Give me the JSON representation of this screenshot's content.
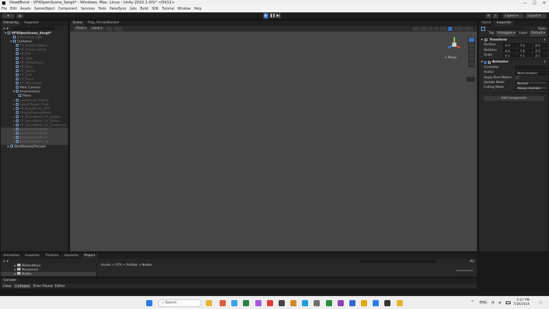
{
  "window": {
    "title": "DeadBurst - VFXOpenScene_Sergii* - Windows, Mac, Linux - Unity 2022.1.0f1* <DX11>",
    "controls": [
      "—",
      "☐",
      "✕"
    ]
  },
  "menu": [
    "File",
    "Edit",
    "Assets",
    "GameObject",
    "Component",
    "Services",
    "Tools",
    "PanelSync",
    "Jobs",
    "Build",
    "SDK",
    "Tutorial",
    "Window",
    "Help"
  ],
  "toolbar": {
    "layers_label": "Layers",
    "layout_label": "Layout"
  },
  "hierarchy": {
    "tab_hierarchy": "Hierarchy",
    "tab_inspector": "Inspector",
    "scene_name": "VFXOpenScene_Sergii*",
    "items": [
      {
        "label": "Container",
        "dim": false
      },
      {
        "label": "Container",
        "dim": false
      },
      {
        "label": "FX_DistanceWave",
        "dim": true
      },
      {
        "label": "FX_DistanceGlow",
        "dim": true
      },
      {
        "label": "FX_Orb",
        "dim": true
      },
      {
        "label": "FX_Tube",
        "dim": true
      },
      {
        "label": "FX_PortalCloud",
        "dim": true
      },
      {
        "label": "FX_Wisp",
        "dim": true
      },
      {
        "label": "FX_Sparks",
        "dim": true
      },
      {
        "label": "FX_Trail",
        "dim": true
      },
      {
        "label": "FX_Burst",
        "dim": true
      },
      {
        "label": "FX_ShockTube",
        "dim": true
      },
      {
        "label": "Main Camera",
        "dim": false
      },
      {
        "label": "Environment",
        "dim": false
      },
      {
        "label": "Plane",
        "dim": false
      },
      {
        "label": "LookAtCam_Parent",
        "dim": true
      },
      {
        "label": "LookAtTarget_Final",
        "dim": true
      },
      {
        "label": "FX_BodyNodes_VFX",
        "dim": true
      },
      {
        "label": "SimpleCameraMode",
        "dim": true
      },
      {
        "label": "FX_ShockNode_Hit_Stable",
        "dim": true
      },
      {
        "label": "FX_ShockNode_Hit_Direct",
        "dim": true
      },
      {
        "label": "FX_ShockNode_Hit_Combined",
        "dim": true
      },
      {
        "label": "BurstColumnNode",
        "dim": true
      },
      {
        "label": "BurstColumnTrails",
        "dim": true
      },
      {
        "label": "BurstColumnGlow",
        "dim": true
      },
      {
        "label": "BurstTrailsNode_Ty",
        "dim": true
      }
    ],
    "dont_destroy": "DontDestroyOnLoad"
  },
  "scene": {
    "tab_scene": "Scene",
    "tab_prefab": "Prop_TerrainBlasted",
    "pivot_label": "Pivot",
    "local_label": "Local",
    "gizmo_label": "< Persp"
  },
  "inspector": {
    "tab_game": "Game",
    "tab_inspector": "Inspector",
    "static_label": "Static",
    "tag_label": "Tag",
    "tag_value": "Untagged",
    "layer_label": "Layer",
    "layer_value": "Default",
    "transform_title": "Transform",
    "position_label": "Position",
    "rotation_label": "Rotation",
    "scale_label": "Scale",
    "pos": [
      "0",
      "0",
      "0"
    ],
    "rot": [
      "0",
      "0",
      "0"
    ],
    "scl": [
      "1",
      "1",
      "1"
    ],
    "animator_title": "Animator",
    "controller_label": "Controller",
    "controller_value": "",
    "avatar_label": "Avatar",
    "avatar_value": "None (Avatar)",
    "root_motion_label": "Apply Root Motion",
    "update_mode_label": "Update Mode",
    "update_mode_value": "Normal",
    "culling_mode_label": "Culling Mode",
    "culling_mode_value": "Always Animate",
    "add_component": "Add Component"
  },
  "bottom": {
    "tabs": [
      "Animation",
      "Inspector",
      "Timeline",
      "Inspector",
      "Project"
    ],
    "folders": [
      "MoltenWave",
      "Movement",
      "Nodes"
    ],
    "breadcrumb": [
      "Assets",
      "VFX",
      "Prefabs",
      "Nodes"
    ],
    "count_label": "42",
    "console_tab": "Console",
    "console_buttons": [
      "Clear",
      "Collapse",
      "Error Pause",
      "Editor"
    ]
  },
  "taskbar": {
    "search_placeholder": "Search",
    "lang": "ENG",
    "time": "5:27 PM",
    "date": "7/30/2024",
    "app_colors": [
      "#e7b431",
      "#d95f3b",
      "#3ba0e8",
      "#2d7d46",
      "#a35ad8",
      "#df3b3b",
      "#444444",
      "#d08a2a",
      "#1f9ed8",
      "#6e6e6e",
      "#2b8a3e",
      "#8e44ad",
      "#3366cc",
      "#e0a800",
      "#2c7be5"
    ]
  }
}
